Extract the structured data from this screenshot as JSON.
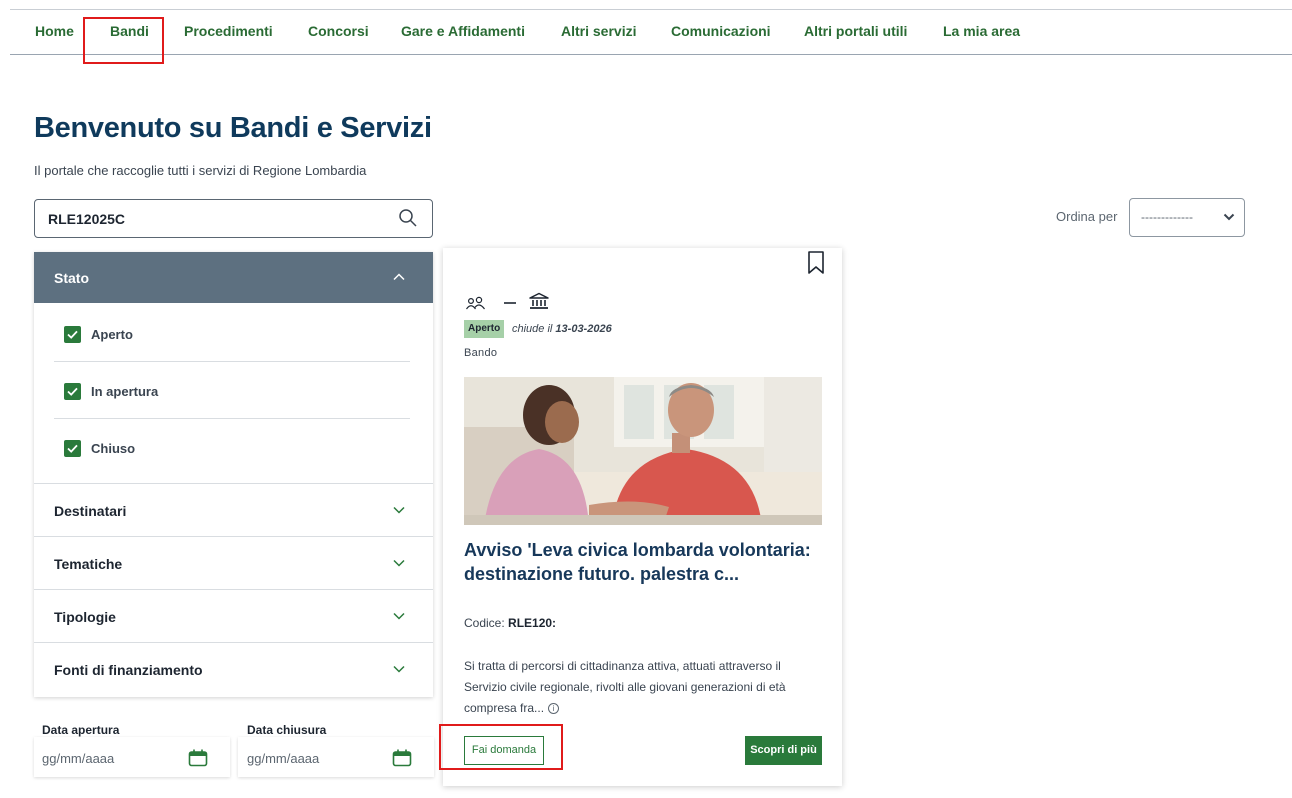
{
  "nav": {
    "items": [
      "Home",
      "Bandi",
      "Procedimenti",
      "Concorsi",
      "Gare e Affidamenti",
      "Altri servizi",
      "Comunicazioni",
      "Altri portali utili",
      "La mia area"
    ],
    "highlighted_item": "Bandi"
  },
  "page": {
    "title": "Benvenuto su Bandi e Servizi",
    "subtitle": "Il portale che raccoglie tutti i servizi di Regione Lombardia"
  },
  "search": {
    "value": "RLE12025C",
    "icon": "search-icon"
  },
  "sort": {
    "label": "Ordina per",
    "value": "-------------"
  },
  "filters": {
    "stato": {
      "title": "Stato",
      "expanded": true,
      "options": [
        {
          "label": "Aperto",
          "checked": true
        },
        {
          "label": "In apertura",
          "checked": true
        },
        {
          "label": "Chiuso",
          "checked": true
        }
      ]
    },
    "sections": [
      "Destinatari",
      "Tematiche",
      "Tipologie",
      "Fonti di finanziamento"
    ]
  },
  "dates": {
    "open_label": "Data apertura",
    "close_label": "Data chiusura",
    "placeholder": "gg/mm/aaaa"
  },
  "card": {
    "status": "Aperto",
    "closes_text": "chiude il",
    "closes_date": "13-03-2026",
    "type": "Bando",
    "title": "Avviso 'Leva civica lombarda volontaria: destinazione futuro. palestra c...",
    "code_label": "Codice:",
    "code_value": "RLE120:",
    "description": "Si tratta di percorsi di cittadinanza attiva, attuati attraverso il Servizio civile regionale, rivolti alle giovani generazioni di età compresa fra...",
    "apply_label": "Fai domanda",
    "more_label": "Scopri di più"
  },
  "colors": {
    "brand_green": "#2a7a3b",
    "nav_text": "#2a6b34",
    "title_blue": "#0f3a5c",
    "panel_header": "#5d7080",
    "highlight_red": "#e01b1b"
  }
}
